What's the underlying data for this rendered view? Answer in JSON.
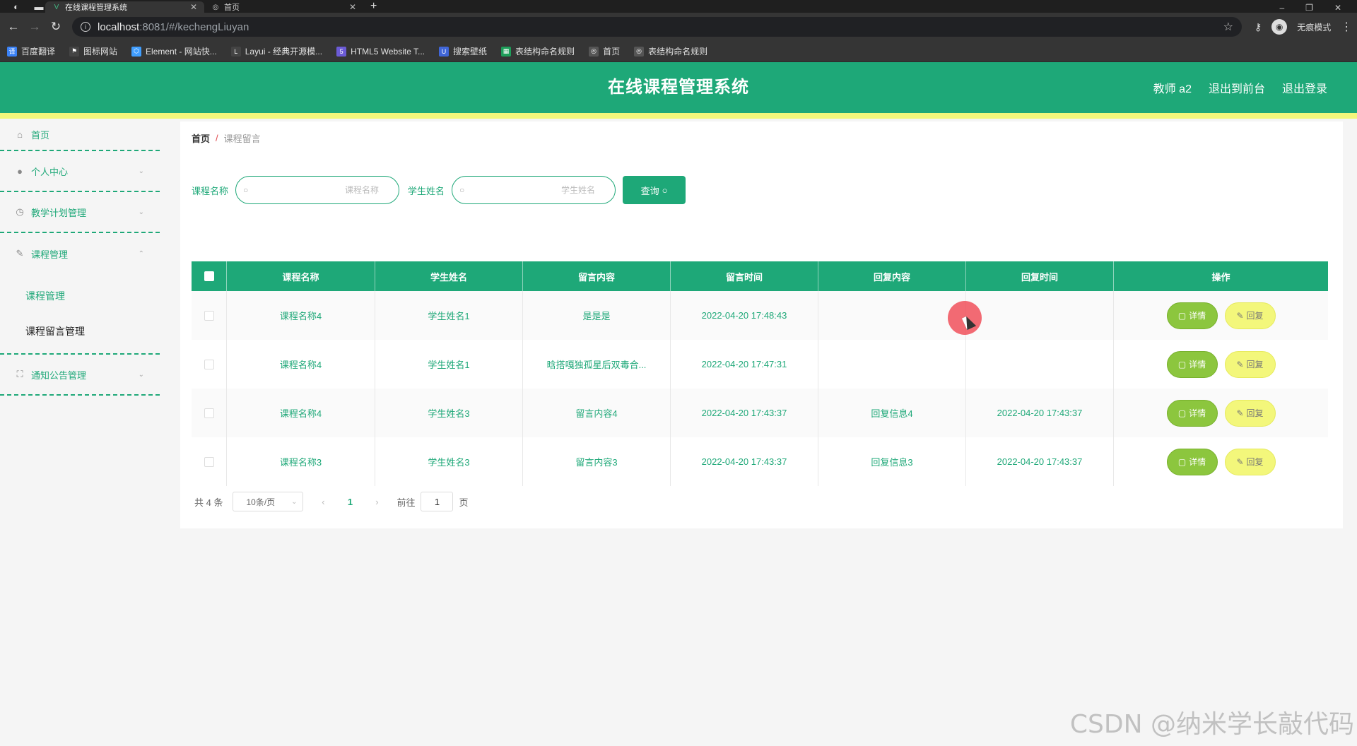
{
  "browser": {
    "tabs": [
      {
        "title": "在线课程管理系统",
        "active": true
      },
      {
        "title": "首页",
        "active": false
      }
    ],
    "url_host": "localhost",
    "url_rest": ":8081/#/kechengLiuyan",
    "profile_label": "无痕模式",
    "bookmarks": [
      {
        "label": "百度翻译",
        "icon": "translate-icon",
        "color": "#3b82f6"
      },
      {
        "label": "图标网站",
        "icon": "flag-icon",
        "color": "#444444"
      },
      {
        "label": "Element - 网站快...",
        "icon": "element-icon",
        "color": "#409eff"
      },
      {
        "label": "Layui - 经典开源模...",
        "icon": "layui-icon",
        "color": "#444444"
      },
      {
        "label": "HTML5 Website T...",
        "icon": "html5-icon",
        "color": "#6b5bd6"
      },
      {
        "label": "搜索壁纸",
        "icon": "wallpaper-icon",
        "color": "#4066d8"
      },
      {
        "label": "表结构命名规则",
        "icon": "sheet-icon",
        "color": "#1e9e5a"
      },
      {
        "label": "首页",
        "icon": "globe-icon",
        "color": "#555555"
      },
      {
        "label": "表结构命名规则",
        "icon": "globe-icon",
        "color": "#555555"
      }
    ]
  },
  "header": {
    "title": "在线课程管理系统",
    "user": "教师 a2",
    "to_front": "退出到前台",
    "logout": "退出登录"
  },
  "sidebar": {
    "home": "首页",
    "personal": "个人中心",
    "teaching_plan": "教学计划管理",
    "course_mgmt": "课程管理",
    "sub_items": [
      "课程管理",
      "课程留言管理"
    ],
    "notice": "通知公告管理"
  },
  "breadcrumb": {
    "home": "首页",
    "sep": "/",
    "current": "课程留言"
  },
  "search": {
    "course_label": "课程名称",
    "course_placeholder": "课程名称",
    "student_label": "学生姓名",
    "student_placeholder": "学生姓名",
    "query_btn": "查询"
  },
  "table": {
    "headers": [
      "课程名称",
      "学生姓名",
      "留言内容",
      "留言时间",
      "回复内容",
      "回复时间",
      "操作"
    ],
    "rows": [
      {
        "course": "课程名称4",
        "student": "学生姓名1",
        "content": "是是是",
        "time": "2022-04-20 17:48:43",
        "reply": "",
        "reply_time": ""
      },
      {
        "course": "课程名称4",
        "student": "学生姓名1",
        "content": "晗搭嘎独孤星后双毒合...",
        "time": "2022-04-20 17:47:31",
        "reply": "",
        "reply_time": ""
      },
      {
        "course": "课程名称4",
        "student": "学生姓名3",
        "content": "留言内容4",
        "time": "2022-04-20 17:43:37",
        "reply": "回复信息4",
        "reply_time": "2022-04-20 17:43:37"
      },
      {
        "course": "课程名称3",
        "student": "学生姓名3",
        "content": "留言内容3",
        "time": "2022-04-20 17:43:37",
        "reply": "回复信息3",
        "reply_time": "2022-04-20 17:43:37"
      }
    ],
    "detail_btn": "详情",
    "reply_btn": "回复"
  },
  "pagination": {
    "total": "共 4 条",
    "page_size": "10条/页",
    "current_page": "1",
    "goto_label": "前往",
    "goto_value": "1",
    "page_unit": "页"
  },
  "watermark": "CSDN @纳米学长敲代码",
  "colors": {
    "primary": "#1ea878",
    "accent_yellow": "#f3f77b",
    "detail_green": "#8cc63e"
  }
}
